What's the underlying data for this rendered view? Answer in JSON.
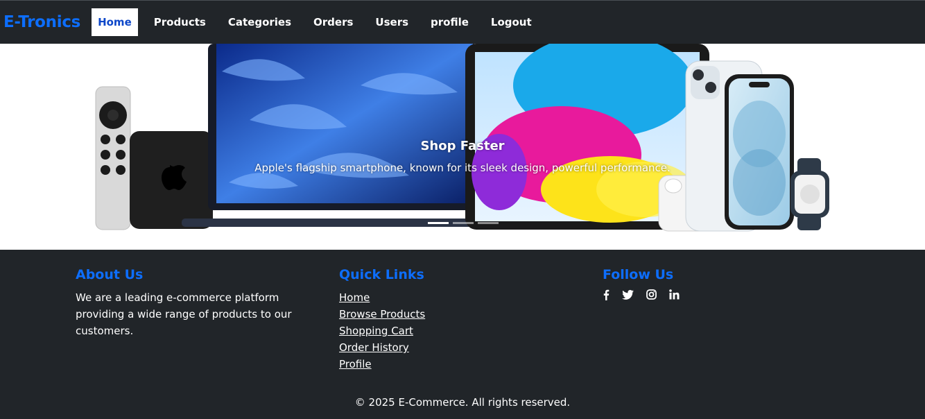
{
  "brand": "E-Tronics",
  "nav": {
    "items": [
      {
        "label": "Home",
        "active": true
      },
      {
        "label": "Products"
      },
      {
        "label": "Categories"
      },
      {
        "label": "Orders"
      },
      {
        "label": "Users"
      },
      {
        "label": "profile"
      },
      {
        "label": "Logout"
      }
    ]
  },
  "hero": {
    "title": "Shop Faster",
    "text": "Apple's flagship smartphone, known for its sleek design, powerful performance.",
    "slides": 3,
    "active_slide": 1
  },
  "footer": {
    "about": {
      "heading": "About Us",
      "text": "We are a leading e-commerce platform providing a wide range of products to our customers."
    },
    "quick_links": {
      "heading": "Quick Links",
      "links": [
        "Home",
        "Browse Products",
        "Shopping Cart",
        "Order History",
        "Profile"
      ]
    },
    "follow": {
      "heading": "Follow Us",
      "icons": [
        "facebook-icon",
        "twitter-icon",
        "instagram-icon",
        "linkedin-icon"
      ]
    },
    "copyright": "© 2025 E-Commerce. All rights reserved."
  },
  "colors": {
    "accent": "#0d6efd",
    "dark_bg": "#212529"
  }
}
